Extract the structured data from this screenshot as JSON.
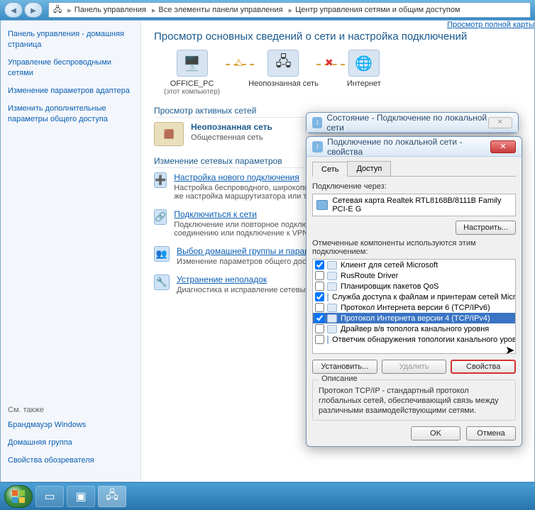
{
  "breadcrumb": {
    "a": "Панель управления",
    "b": "Все элементы панели управления",
    "c": "Центр управления сетями и общим доступом"
  },
  "sidebar": {
    "items": [
      "Панель управления - домашняя страница",
      "Управление беспроводными сетями",
      "Изменение параметров адаптера",
      "Изменить дополнительные параметры общего доступа"
    ],
    "seeAlsoHdr": "См. также",
    "seeAlso": [
      "Брандмауэр Windows",
      "Домашняя группа",
      "Свойства обозревателя"
    ]
  },
  "page": {
    "title": "Просмотр основных сведений о сети и настройка подключений",
    "mapLink": "Просмотр полной карты",
    "map": {
      "pc": "OFFICE_PC",
      "pcSub": "(этот компьютер)",
      "net": "Неопознанная сеть",
      "inet": "Интернет"
    },
    "activeHdr": "Просмотр активных сетей",
    "active": {
      "name": "Неопознанная сеть",
      "type": "Общественная сеть"
    },
    "paramsHdr": "Изменение сетевых параметров",
    "params": [
      {
        "title": "Настройка нового подключения",
        "desc": "Настройка беспроводного, широкополосного, модемного, прямого или VPN-подключения или же настройка маршрутизатора или точки доступа."
      },
      {
        "title": "Подключиться к сети",
        "desc": "Подключение или повторное подключение к беспроводному, проводному, модемному сетевому соединению или подключение к VPN."
      },
      {
        "title": "Выбор домашней группы и параметров общего доступа",
        "desc": "Изменение параметров общего доступа."
      },
      {
        "title": "Устранение неполадок",
        "desc": "Диагностика и исправление сетевых проблем."
      }
    ]
  },
  "statusDlg": {
    "title": "Состояние - Подключение по локальной сети"
  },
  "propDlg": {
    "title": "Подключение по локальной сети - свойства",
    "tabs": {
      "net": "Сеть",
      "access": "Доступ"
    },
    "connVia": "Подключение через:",
    "adapter": "Сетевая карта Realtek RTL8168B/8111B Family PCI-E G",
    "configureBtn": "Настроить...",
    "componentsLbl": "Отмеченные компоненты используются этим подключением:",
    "items": [
      {
        "chk": true,
        "label": "Клиент для сетей Microsoft"
      },
      {
        "chk": false,
        "label": "RusRoute Driver"
      },
      {
        "chk": false,
        "label": "Планировщик пакетов QoS"
      },
      {
        "chk": true,
        "label": "Служба доступа к файлам и принтерам сетей Micro..."
      },
      {
        "chk": false,
        "label": "Протокол Интернета версии 6 (TCP/IPv6)"
      },
      {
        "chk": true,
        "label": "Протокол Интернета версии 4 (TCP/IPv4)",
        "sel": true
      },
      {
        "chk": false,
        "label": "Драйвер в/в тополога канального уровня"
      },
      {
        "chk": false,
        "label": "Ответчик обнаружения топологии канального уровня"
      }
    ],
    "installBtn": "Установить...",
    "removeBtn": "Удалить",
    "propsBtn": "Свойства",
    "descHdr": "Описание",
    "descTxt": "Протокол TCP/IP - стандартный протокол глобальных сетей, обеспечивающий связь между различными взаимодействующими сетями.",
    "ok": "OK",
    "cancel": "Отмена"
  }
}
